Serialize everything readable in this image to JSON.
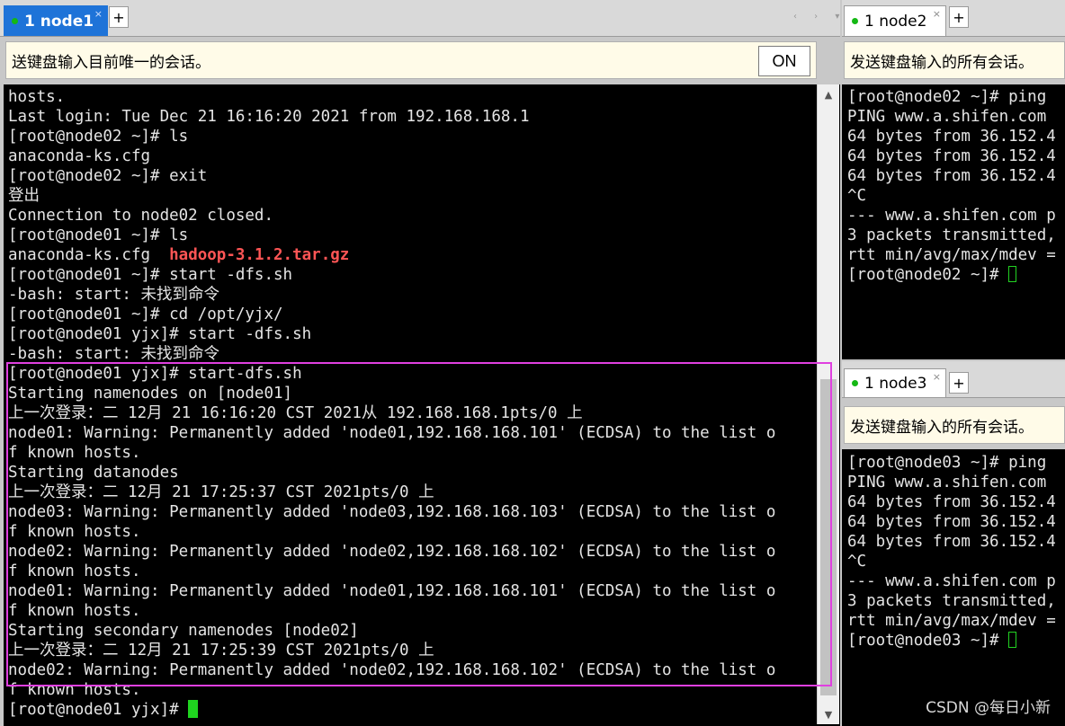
{
  "left": {
    "tab": {
      "label": "1 node1",
      "close": "×"
    },
    "plus": "+",
    "nav": "‹ › ▾",
    "broadcast": {
      "text": "送键盘输入目前唯一的会话。",
      "button": "ON"
    },
    "lines": [
      "hosts.",
      "Last login: Tue Dec 21 16:16:20 2021 from 192.168.168.1",
      "[root@node02 ~]# ls",
      "anaconda-ks.cfg",
      "[root@node02 ~]# exit",
      "登出",
      "Connection to node02 closed.",
      "[root@node01 ~]# ls",
      "anaconda-ks.cfg  ",
      "[root@node01 ~]# start -dfs.sh",
      "-bash: start: 未找到命令",
      "[root@node01 ~]# cd /opt/yjx/",
      "[root@node01 yjx]# start -dfs.sh",
      "-bash: start: 未找到命令",
      "[root@node01 yjx]# start-dfs.sh",
      "Starting namenodes on [node01]",
      "上一次登录：二 12月 21 16:16:20 CST 2021从 192.168.168.1pts/0 上",
      "node01: Warning: Permanently added 'node01,192.168.168.101' (ECDSA) to the list o",
      "f known hosts.",
      "Starting datanodes",
      "上一次登录：二 12月 21 17:25:37 CST 2021pts/0 上",
      "node03: Warning: Permanently added 'node03,192.168.168.103' (ECDSA) to the list o",
      "f known hosts.",
      "node02: Warning: Permanently added 'node02,192.168.168.102' (ECDSA) to the list o",
      "f known hosts.",
      "node01: Warning: Permanently added 'node01,192.168.168.101' (ECDSA) to the list o",
      "f known hosts.",
      "Starting secondary namenodes [node02]",
      "上一次登录：二 12月 21 17:25:39 CST 2021pts/0 上",
      "node02: Warning: Permanently added 'node02,192.168.168.102' (ECDSA) to the list o",
      "f known hosts.",
      "[root@node01 yjx]# "
    ],
    "highlight_file": "hadoop-3.1.2.tar.gz"
  },
  "node2": {
    "tab": {
      "label": "1 node2",
      "close": "×"
    },
    "plus": "+",
    "broadcast": "发送键盘输入的所有会话。",
    "lines": [
      "[root@node02 ~]# ping",
      "PING www.a.shifen.com",
      "64 bytes from 36.152.4",
      "64 bytes from 36.152.4",
      "64 bytes from 36.152.4",
      "^C",
      "--- www.a.shifen.com p",
      "3 packets transmitted,",
      "rtt min/avg/max/mdev =",
      "[root@node02 ~]# "
    ]
  },
  "node3": {
    "tab": {
      "label": "1 node3",
      "close": "×"
    },
    "plus": "+",
    "broadcast": "发送键盘输入的所有会话。",
    "lines": [
      "[root@node03 ~]# ping",
      "PING www.a.shifen.com",
      "64 bytes from 36.152.4",
      "64 bytes from 36.152.4",
      "64 bytes from 36.152.4",
      "^C",
      "--- www.a.shifen.com p",
      "3 packets transmitted,",
      "rtt min/avg/max/mdev =",
      "[root@node03 ~]# "
    ]
  },
  "watermark": "CSDN @每日小新",
  "colors": {
    "active_tab": "#1e73d8",
    "status_dot": "#14b814",
    "cursor": "#1fd41f",
    "highlight_box": "#e040e0",
    "filename": "#ff5555"
  },
  "icons": [
    "close-icon",
    "add-tab-icon",
    "status-dot-icon",
    "scroll-up-icon",
    "scroll-down-icon"
  ]
}
